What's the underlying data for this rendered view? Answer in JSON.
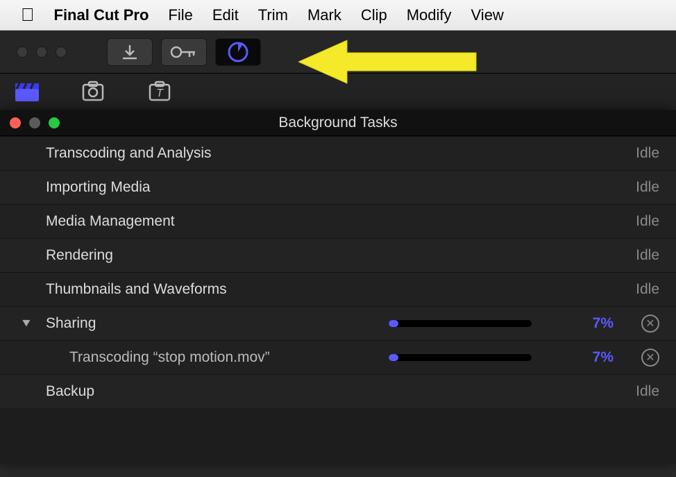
{
  "menubar": {
    "app_name": "Final Cut Pro",
    "items": [
      "File",
      "Edit",
      "Trim",
      "Mark",
      "Clip",
      "Modify",
      "View"
    ]
  },
  "toolbar": {
    "buttons": {
      "import": "import-icon",
      "keyword": "keyword-icon",
      "background_tasks": "background-tasks-icon"
    }
  },
  "bt_window": {
    "title": "Background Tasks",
    "rows": [
      {
        "label": "Transcoding and Analysis",
        "status": "Idle"
      },
      {
        "label": "Importing Media",
        "status": "Idle"
      },
      {
        "label": "Media Management",
        "status": "Idle"
      },
      {
        "label": "Rendering",
        "status": "Idle"
      },
      {
        "label": "Thumbnails and Waveforms",
        "status": "Idle"
      },
      {
        "label": "Sharing",
        "progress": 7,
        "percent_label": "7%",
        "expanded": true
      },
      {
        "label": "Transcoding “stop motion.mov”",
        "progress": 7,
        "percent_label": "7%",
        "sub": true
      },
      {
        "label": "Backup",
        "status": "Idle"
      }
    ]
  },
  "colors": {
    "accent": "#5a5aff",
    "annotation": "#f5ea2a"
  }
}
